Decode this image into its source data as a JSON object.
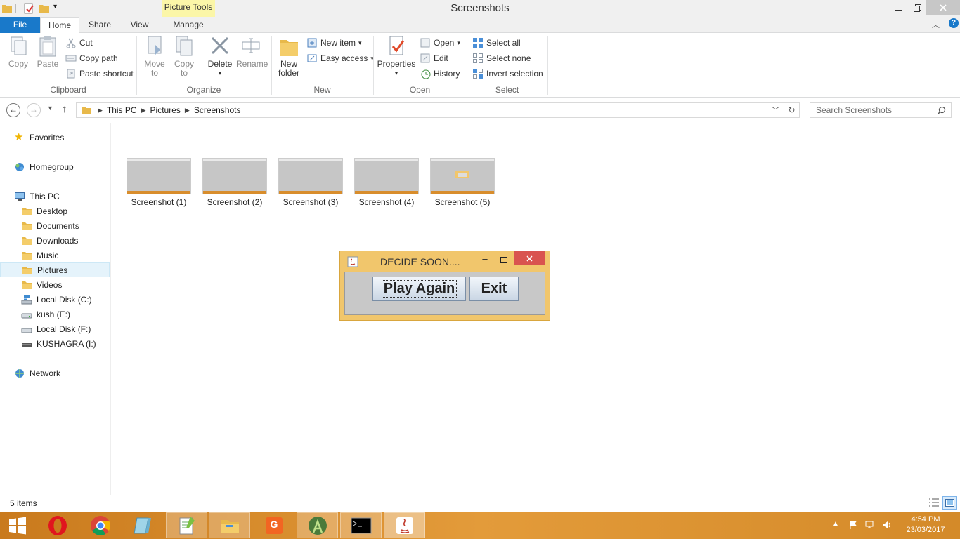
{
  "window": {
    "title": "Screenshots",
    "context_tab": "Picture Tools"
  },
  "tabs": {
    "file": "File",
    "home": "Home",
    "share": "Share",
    "view": "View",
    "manage": "Manage"
  },
  "ribbon": {
    "clipboard": {
      "label": "Clipboard",
      "copy": "Copy",
      "paste": "Paste",
      "cut": "Cut",
      "copy_path": "Copy path",
      "paste_shortcut": "Paste shortcut"
    },
    "organize": {
      "label": "Organize",
      "move_to_1": "Move",
      "move_to_2": "to",
      "copy_to_1": "Copy",
      "copy_to_2": "to",
      "delete": "Delete",
      "rename": "Rename"
    },
    "new": {
      "label": "New",
      "new_folder_1": "New",
      "new_folder_2": "folder",
      "new_item": "New item",
      "easy_access": "Easy access"
    },
    "open": {
      "label": "Open",
      "properties": "Properties",
      "open": "Open",
      "edit": "Edit",
      "history": "History"
    },
    "select": {
      "label": "Select",
      "select_all": "Select all",
      "select_none": "Select none",
      "invert_selection": "Invert selection"
    }
  },
  "address": {
    "crumbs": [
      "This PC",
      "Pictures",
      "Screenshots"
    ]
  },
  "search": {
    "placeholder": "Search Screenshots"
  },
  "nav": {
    "favorites": "Favorites",
    "homegroup": "Homegroup",
    "this_pc": "This PC",
    "items": [
      "Desktop",
      "Documents",
      "Downloads",
      "Music",
      "Pictures",
      "Videos",
      "Local Disk (C:)",
      "kush (E:)",
      "Local Disk (F:)",
      "KUSHAGRA (I:)"
    ],
    "network": "Network"
  },
  "files": [
    "Screenshot (1)",
    "Screenshot (2)",
    "Screenshot (3)",
    "Screenshot (4)",
    "Screenshot (5)"
  ],
  "dialog": {
    "title": "DECIDE SOON....",
    "play_again": "Play Again",
    "exit": "Exit"
  },
  "status": {
    "count": "5 items"
  },
  "taskbar": {
    "time": "4:54 PM",
    "date": "23/03/2017"
  },
  "colors": {
    "accent": "#1979ca",
    "taskbar": "#d98f2f",
    "dialog_frame": "#f1c66c",
    "close_red": "#d9534f"
  }
}
